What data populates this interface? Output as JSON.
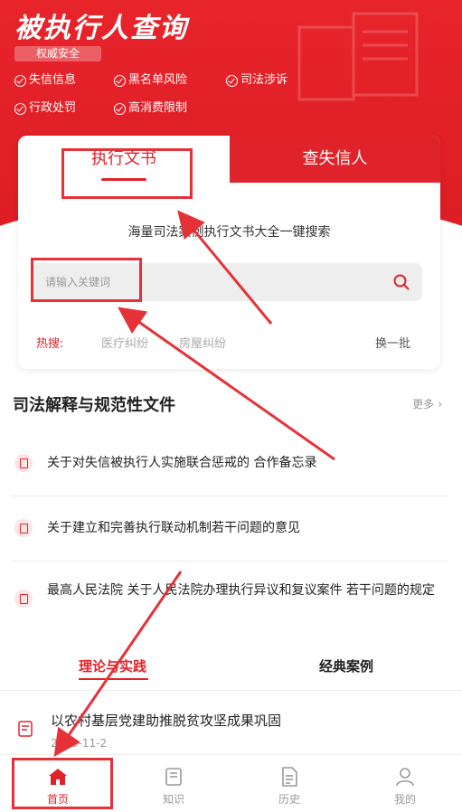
{
  "header": {
    "title": "被执行人查询",
    "badge": "权威安全",
    "features": [
      "失信信息",
      "黑名单风险",
      "司法涉诉",
      "行政处罚",
      "高消费限制"
    ]
  },
  "search_card": {
    "tabs": [
      {
        "label": "执行文书",
        "active": true
      },
      {
        "label": "查失信人",
        "active": false
      }
    ],
    "slogan": "海量司法案例执行文书大全一键搜索",
    "search_placeholder": "请输入关键词",
    "hot_label": "热搜:",
    "hot_tags": [
      "医疗纠纷",
      "房屋纠纷"
    ],
    "refresh_label": "换一批"
  },
  "judicial_section": {
    "title": "司法解释与规范性文件",
    "more_label": "更多",
    "items": [
      "关于对失信被执行人实施联合惩戒的 合作备忘录",
      "关于建立和完善执行联动机制若干问题的意见",
      "最高人民法院 关于人民法院办理执行异议和复议案件 若干问题的规定"
    ]
  },
  "sub_tabs": [
    {
      "label": "理论与实践",
      "active": true
    },
    {
      "label": "经典案例",
      "active": false
    }
  ],
  "article": {
    "title": "以农村基层党建助推脱贫攻坚成果巩固",
    "date": "2019-11-2"
  },
  "bottom_nav": [
    {
      "label": "首页",
      "icon": "home-icon",
      "active": true
    },
    {
      "label": "知识",
      "icon": "book-icon",
      "active": false
    },
    {
      "label": "历史",
      "icon": "document-icon",
      "active": false
    },
    {
      "label": "我的",
      "icon": "user-icon",
      "active": false
    }
  ],
  "colors": {
    "brand_red": "#e0232a",
    "annotation_red": "#e53238"
  }
}
